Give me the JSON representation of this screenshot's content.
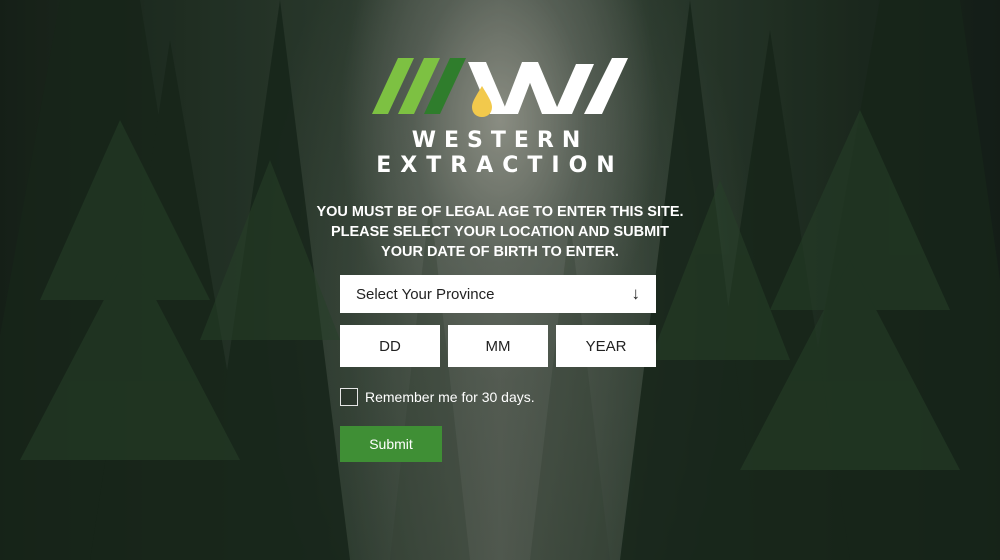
{
  "brand": {
    "line1": "WESTERN",
    "line2": "EXTRACTION",
    "logo_icon": "western-extraction-logo"
  },
  "age_gate": {
    "notice_lines": [
      "YOU MUST BE OF LEGAL AGE TO ENTER THIS SITE.",
      "PLEASE SELECT YOUR LOCATION AND SUBMIT",
      "YOUR DATE OF BIRTH TO ENTER."
    ],
    "province_select": {
      "selected": "Select Your Province",
      "arrow": "↓"
    },
    "dob": {
      "day_placeholder": "DD",
      "month_placeholder": "MM",
      "year_placeholder": "YEAR"
    },
    "remember_label": "Remember me for 30 days.",
    "submit_label": "Submit"
  },
  "colors": {
    "accent_green": "#3f8f35",
    "logo_light_green": "#7dc142",
    "logo_dark_green": "#2f7d2c",
    "drop_yellow": "#f2c94c"
  }
}
